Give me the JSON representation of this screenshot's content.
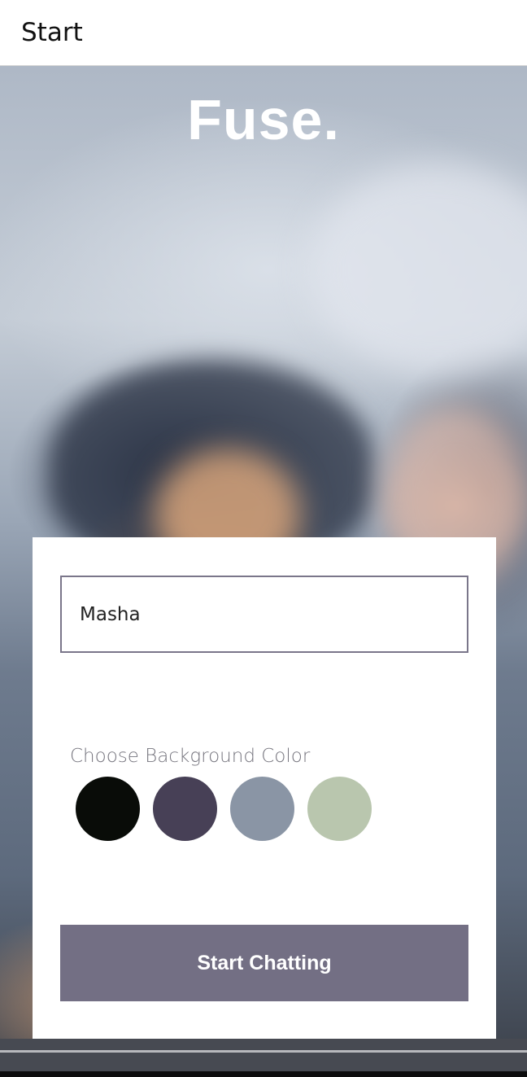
{
  "header": {
    "title": "Start"
  },
  "app": {
    "title": "Fuse."
  },
  "form": {
    "name_value": "Masha",
    "color_label": "Choose Background Color",
    "colors": [
      "#090C08",
      "#474056",
      "#8A95A5",
      "#B9C6AE"
    ],
    "start_button_label": "Start Chatting"
  },
  "theme": {
    "button_color": "#736F84",
    "input_border_color": "#7A768A"
  }
}
